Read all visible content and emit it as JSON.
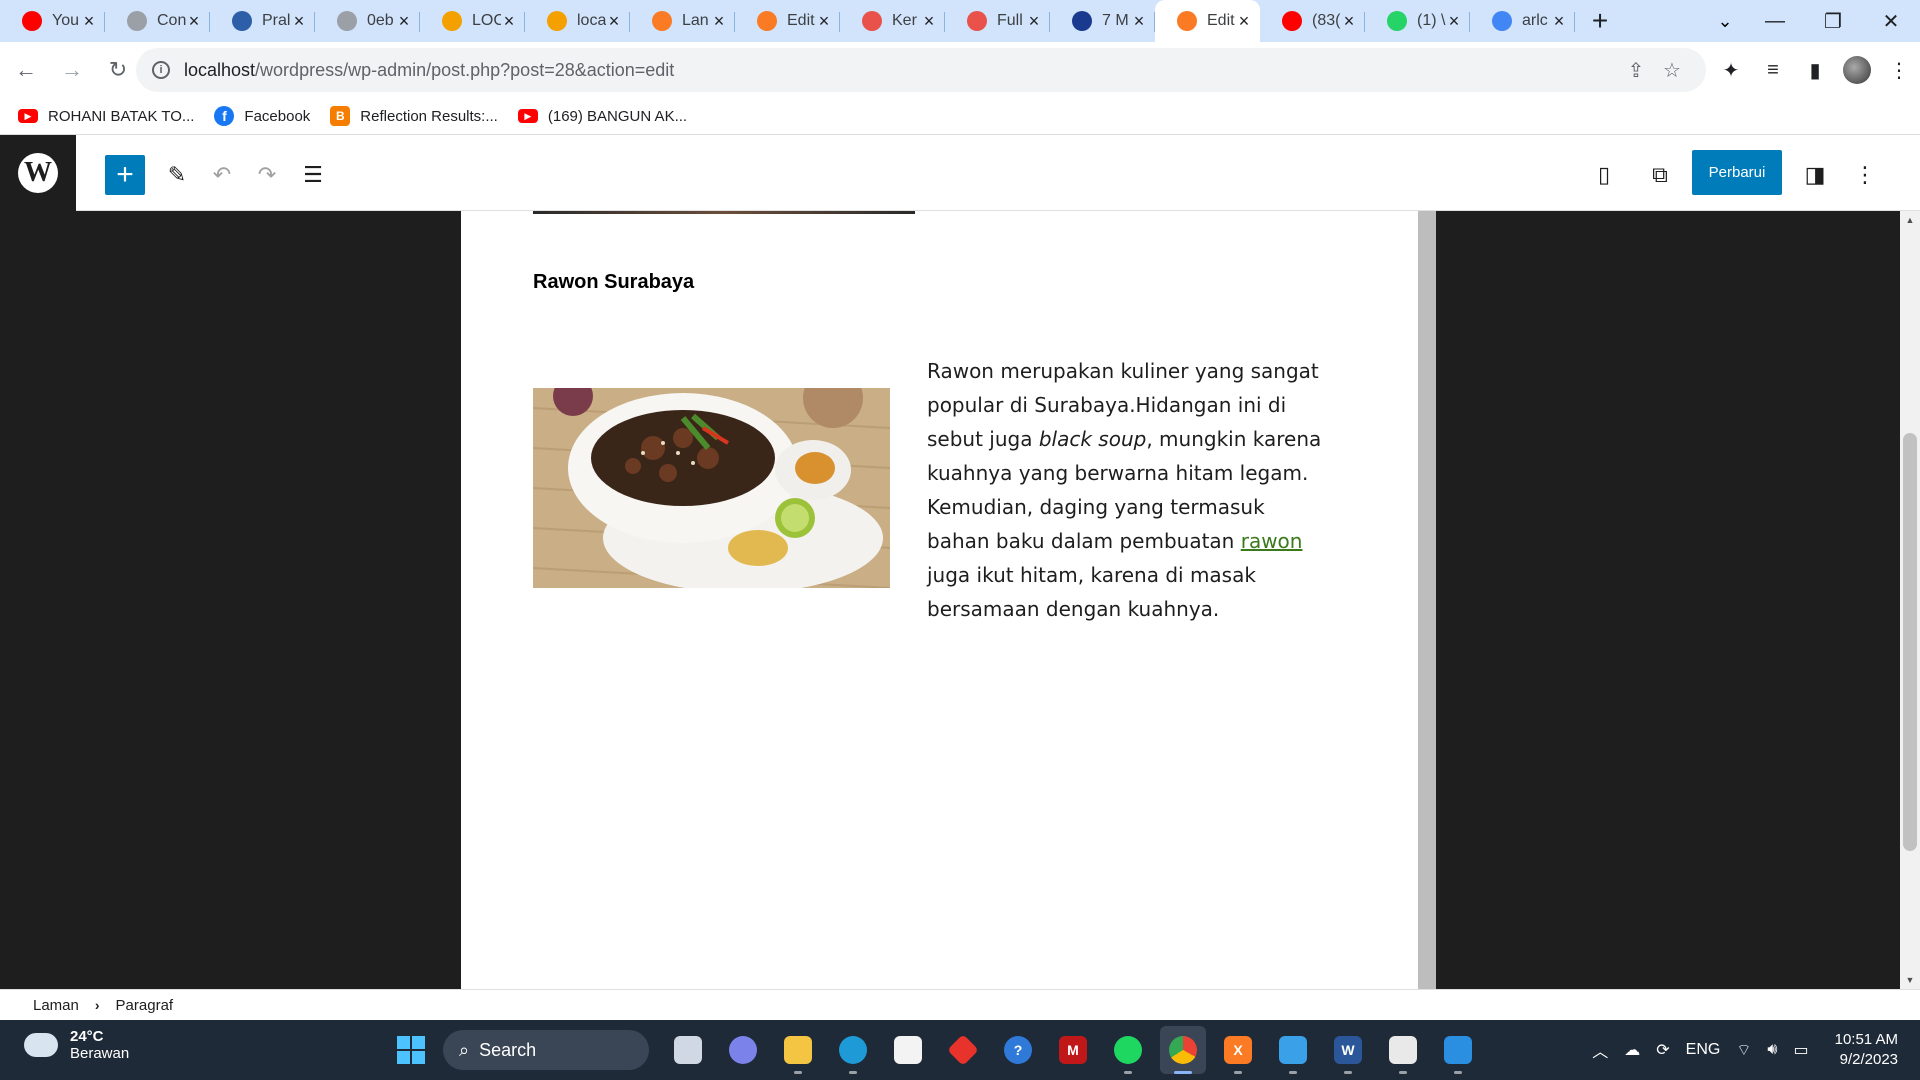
{
  "browser": {
    "tabs": [
      {
        "title": "You",
        "favicon": "youtube-icon",
        "color": "#ff0000",
        "active": false
      },
      {
        "title": "Con",
        "favicon": "globe-icon",
        "color": "#9aa0a6",
        "active": false
      },
      {
        "title": "Pral",
        "favicon": "site-icon",
        "color": "#2d5fa8",
        "active": false
      },
      {
        "title": "0eb",
        "favicon": "globe-icon",
        "color": "#9aa0a6",
        "active": false
      },
      {
        "title": "LOC",
        "favicon": "pma-icon",
        "color": "#f4a000",
        "active": false
      },
      {
        "title": "loca",
        "favicon": "pma-icon",
        "color": "#f4a000",
        "active": false
      },
      {
        "title": "Lan",
        "favicon": "xampp-icon",
        "color": "#fb7a24",
        "active": false
      },
      {
        "title": "Edit",
        "favicon": "xampp-icon",
        "color": "#fb7a24",
        "active": false
      },
      {
        "title": "Ker",
        "favicon": "rainbow-icon",
        "color": "#e8524a",
        "active": false
      },
      {
        "title": "Full",
        "favicon": "rainbow-icon",
        "color": "#e8524a",
        "active": false
      },
      {
        "title": "7 M",
        "favicon": "k-icon",
        "color": "#1a3a8f",
        "active": false
      },
      {
        "title": "Edit",
        "favicon": "xampp-icon",
        "color": "#fb7a24",
        "active": true
      },
      {
        "title": "(83(",
        "favicon": "youtube-icon",
        "color": "#ff0000",
        "active": false
      },
      {
        "title": "(1) \\",
        "favicon": "whatsapp-icon",
        "color": "#25d366",
        "active": false
      },
      {
        "title": "arlc",
        "favicon": "google-icon",
        "color": "#4285f4",
        "active": false
      }
    ],
    "url_host": "localhost",
    "url_path": "/wordpress/wp-admin/post.php?post=28&action=edit",
    "bookmarks": [
      {
        "label": "ROHANI BATAK TO...",
        "icon": "youtube-icon"
      },
      {
        "label": "Facebook",
        "icon": "facebook-icon"
      },
      {
        "label": "Reflection Results:...",
        "icon": "blogger-icon"
      },
      {
        "label": "(169) BANGUN AK...",
        "icon": "youtube-icon"
      }
    ]
  },
  "editor": {
    "update_label": "Perbarui",
    "heading": "Rawon Surabaya",
    "paragraph": {
      "part1": " Rawon merupakan kuliner yang sangat popular di Surabaya.Hidangan ini di sebut juga ",
      "italic": "black soup",
      "part2": ", mungkin karena kuahnya yang berwarna hitam legam. Kemudian, daging yang termasuk bahan baku dalam pembuatan ",
      "link": "rawon ",
      "part3": "juga ikut hitam, karena di masak bersamaan dengan kuahnya."
    },
    "breadcrumb": [
      "Laman",
      "Paragraf"
    ]
  },
  "taskbar": {
    "temperature": "24°C",
    "weather": "Berawan",
    "search_label": "Search",
    "language": "ENG",
    "time": "10:51 AM",
    "date": "9/2/2023"
  }
}
